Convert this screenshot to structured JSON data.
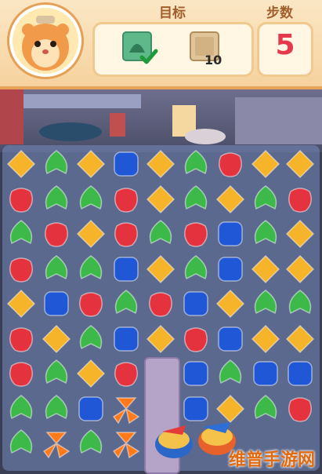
{
  "hud": {
    "goal_label": "目标",
    "steps_label": "步数",
    "steps_value": "5",
    "goals": [
      {
        "icon": "leaf-tile-icon",
        "status": "completed-check"
      },
      {
        "icon": "wooden-box-icon",
        "count": "10"
      }
    ]
  },
  "board": {
    "rows": [
      [
        "yellow",
        "green",
        "yellow",
        "blue",
        "yellow",
        "green",
        "red",
        "yellow",
        "yellow"
      ],
      [
        "red",
        "green",
        "green",
        "red",
        "yellow",
        "green",
        "yellow",
        "green",
        "red"
      ],
      [
        "green",
        "red",
        "yellow",
        "red",
        "green",
        "red",
        "blue",
        "green",
        "yellow"
      ],
      [
        "red",
        "green",
        "green",
        "blue",
        "yellow",
        "green",
        "blue",
        "yellow",
        "yellow"
      ],
      [
        "yellow",
        "blue",
        "red",
        "green",
        "red",
        "blue",
        "yellow",
        "green",
        "green"
      ],
      [
        "red",
        "yellow",
        "green",
        "blue",
        "yellow",
        "red",
        "blue",
        "yellow",
        "yellow"
      ],
      [
        "red",
        "green",
        "yellow",
        "red",
        "",
        "blue",
        "green",
        "blue",
        "blue"
      ],
      [
        "green",
        "green",
        "blue",
        "spinner",
        "",
        "blue",
        "yellow",
        "green",
        "red"
      ],
      [
        "green",
        "spinner",
        "green",
        "spinner",
        "",
        "",
        "",
        "",
        ""
      ]
    ],
    "specials": [
      "rocket-bomb-icon",
      "rocket-bomb-icon"
    ],
    "colors": {
      "red": "#e4323f",
      "green": "#3db94a",
      "yellow": "#f6b42b",
      "blue": "#1f57d6"
    }
  },
  "watermark": "维普手游网"
}
